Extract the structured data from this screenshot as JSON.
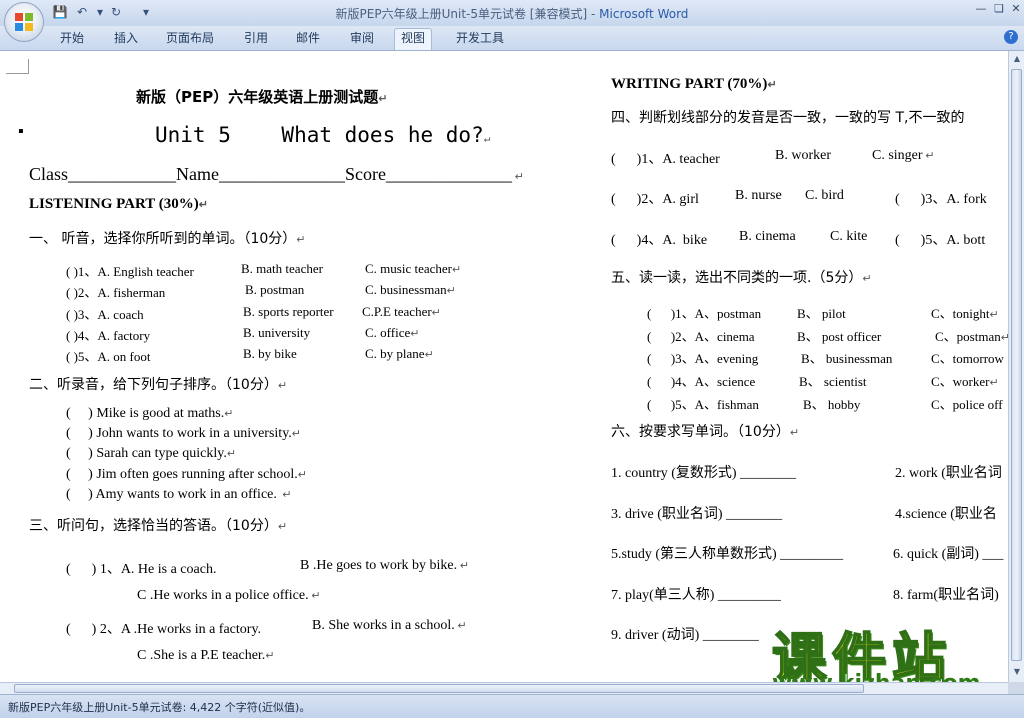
{
  "window": {
    "title": "新版PEP六年级上册Unit-5单元试卷 [兼容模式]",
    "title_sep": " - ",
    "app_name": "Microsoft Word"
  },
  "ribbon": {
    "tabs": [
      "开始",
      "插入",
      "页面布局",
      "引用",
      "邮件",
      "审阅",
      "视图",
      "开发工具"
    ],
    "active_tab": "视图"
  },
  "left_page": {
    "heading": "新版（PEP）六年级英语上册测试题",
    "unit_title": "Unit 5    What does he do?",
    "class_line": "Class____________Name______________Score______________",
    "listening_title": "LISTENING PART (30%)",
    "sec1_title": "一、 听音，选择你所听到的单词。（10分）",
    "sec1_items": [
      {
        "num": "(       )1、A. English teacher",
        "b": "B. math teacher",
        "c": "C. music teacher"
      },
      {
        "num": "(       )2、A. fisherman",
        "b": "B. postman",
        "c": "C. businessman"
      },
      {
        "num": "(       )3、A. coach",
        "b": "B. sports reporter",
        "c": "C.P.E teacher"
      },
      {
        "num": "(       )4、A. factory",
        "b": "B. university",
        "c": "C. office"
      },
      {
        "num": "(       )5、A. on foot",
        "b": "B. by bike",
        "c": "C. by plane"
      }
    ],
    "sec2_title": "二、听录音，给下列句子排序。（10分）",
    "sec2_items": [
      "(     ) Mike is good at maths.",
      "(     ) John wants to work in a university.",
      "(     ) Sarah can type quickly.",
      "(     ) Jim often goes running after school.",
      "(     ) Amy wants to work in an office."
    ],
    "sec3_title": "三、听问句，选择恰当的答语。（10分）",
    "sec3_items": [
      {
        "a": "(      ) 1、A. He is a coach.",
        "b": "B .He goes to work by bike.",
        "c": "C .He works in a police office."
      },
      {
        "a": "(      ) 2、A .He works in a factory.",
        "b": "B. She works in a school.",
        "c": "C .She is a P.E teacher."
      }
    ]
  },
  "right_page": {
    "writing_title": "WRITING PART (70%)",
    "sec4_title": "四、判断划线部分的发音是否一致，一致的写 T,不一致的",
    "sec4_rows": [
      {
        "a": "(      )1、A. teacher",
        "b": "B. worker",
        "c": "C. singer",
        "d": ""
      },
      {
        "a": "(      )2、A. girl",
        "b": "B. nurse",
        "c": "C. bird",
        "d": "(      )3、A. fork"
      },
      {
        "a": "(      )4、A.  bike",
        "b": "B. cinema",
        "c": "C. kite",
        "d": "(      )5、A. bott"
      }
    ],
    "sec5_title": "五、读一读，选出不同类的一项.（5分）",
    "sec5_rows": [
      {
        "a": "(      )1、A、postman",
        "b": "B、 pilot",
        "c": "C、tonight"
      },
      {
        "a": "(      )2、A、cinema",
        "b": "B、 post officer",
        "c": "C、postman"
      },
      {
        "a": "(      )3、A、evening",
        "b": "B、 businessman",
        "c": "C、tomorrow"
      },
      {
        "a": "(      )4、A、science",
        "b": "B、 scientist",
        "c": "C、worker"
      },
      {
        "a": "(      )5、A、fishman",
        "b": "B、 hobby",
        "c": "C、police off"
      }
    ],
    "sec6_title": "六、按要求写单词。（10分）",
    "sec6_rows": [
      {
        "l": "1. country (复数形式) ________",
        "r": "2. work (职业名词"
      },
      {
        "l": "3. drive (职业名词) ________",
        "r": "4.science (职业名"
      },
      {
        "l": "5.study (第三人称单数形式) _________",
        "r": "6. quick (副词) ___"
      },
      {
        "l": "7. play(单三人称) _________",
        "r": "8. farm(职业名词)"
      },
      {
        "l": "9. driver (动词) ________",
        "r": ""
      }
    ]
  },
  "status_bar": {
    "text": "新版PEP六年级上册Unit-5单元试卷: 4,422 个字符(近似值)。"
  },
  "watermark": {
    "big": "课件站",
    "url": "www.kjzhan.com"
  }
}
